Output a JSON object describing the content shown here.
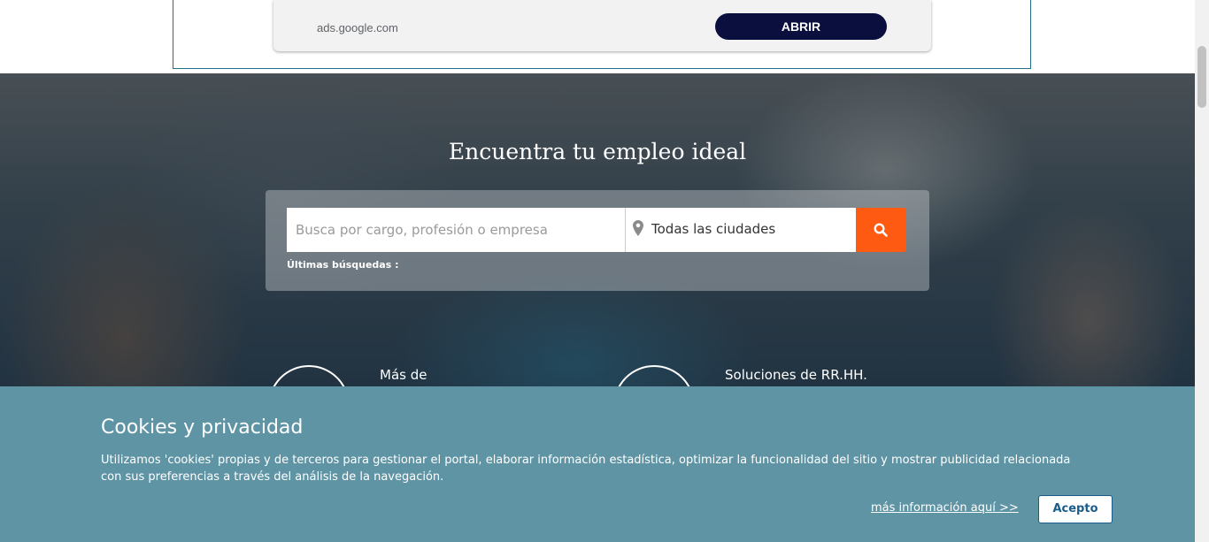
{
  "ad": {
    "url": "ads.google.com",
    "button_label": "ABRIR"
  },
  "hero": {
    "title": "Encuentra tu empleo ideal",
    "search_placeholder": "Busca por cargo, profesión o empresa",
    "city_value": "Todas las ciudades",
    "recent_searches_label": "Últimas búsquedas :",
    "features": [
      {
        "label": "Más de"
      },
      {
        "label": "Soluciones de RR.HH."
      }
    ]
  },
  "cookie": {
    "title": "Cookies y privacidad",
    "text": "Utilizamos 'cookies' propias y de terceros para gestionar el portal, elaborar información estadística, optimizar la funcionalidad del sitio y mostrar publicidad relacionada con sus preferencias a través del análisis de la navegación.",
    "more_info_link": "más información aquí >>",
    "accept_label": "Acepto"
  },
  "icons": {
    "pin": "map-pin-icon",
    "search": "search-icon"
  },
  "colors": {
    "search_button": "#ff5a12",
    "cookie_bar": "#5f94a5",
    "ad_button": "#0a0f3d"
  }
}
